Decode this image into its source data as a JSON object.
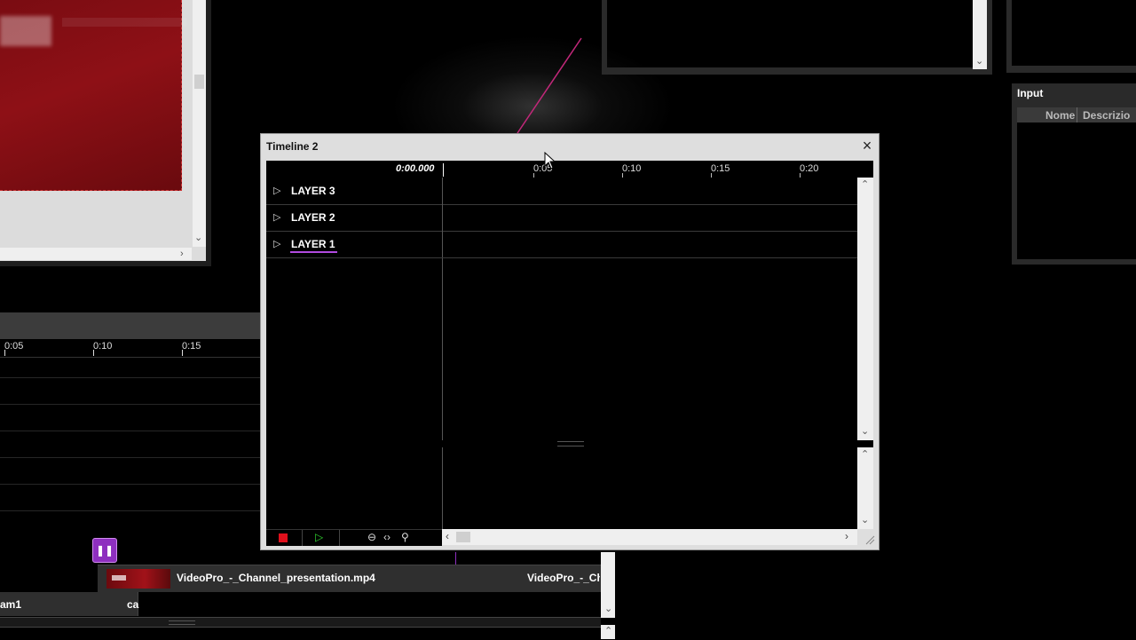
{
  "background": {
    "main_timeline_ruler": [
      "0:05",
      "0:10",
      "0:15"
    ],
    "clip_name": "VideoPro_-_Channel_presentation.mp4",
    "clip_name_2": "VideoPro_-_Ch",
    "cam_label": "am1",
    "cam_label_2": "ca",
    "input_panel": {
      "title": "Input",
      "columns": [
        "Nome",
        "Descrizio"
      ]
    }
  },
  "timeline_window": {
    "title": "Timeline 2",
    "current_time": "0:00.000",
    "ruler_ticks": [
      "0:05",
      "0:10",
      "0:15",
      "0:20"
    ],
    "layers": [
      {
        "label": "LAYER 3",
        "selected": false
      },
      {
        "label": "LAYER 2",
        "selected": false
      },
      {
        "label": "LAYER 1",
        "selected": true
      }
    ],
    "icons": {
      "close": "close-icon",
      "stop": "stop-icon",
      "play": "play-icon",
      "zoom_out": "zoom-out-icon",
      "fit": "fit-icon",
      "zoom": "zoom-icon"
    },
    "accent_color": "#b14be0",
    "stop_color": "#e0101c",
    "play_color": "#2fd12f"
  }
}
